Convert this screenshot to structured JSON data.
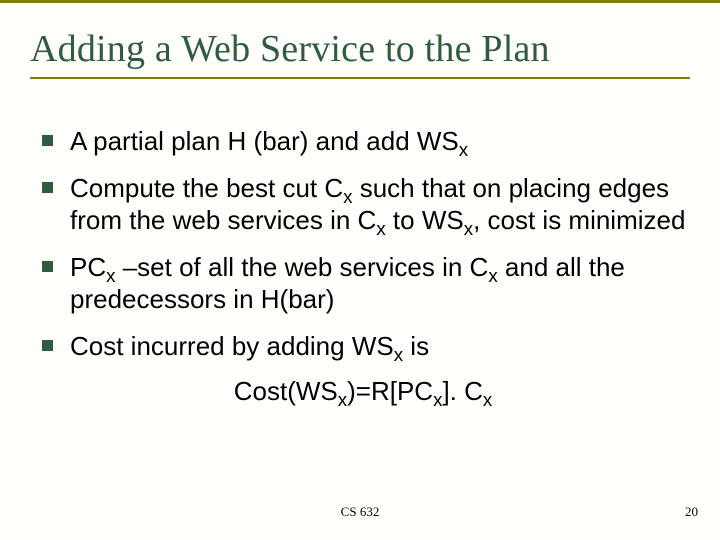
{
  "title": "Adding a Web Service to the Plan",
  "bullets": {
    "b1": {
      "t1": "A partial plan H (bar) and add WS",
      "s1": "x"
    },
    "b2": {
      "t1": "Compute the best cut C",
      "s1": "x",
      "t2": " such that on placing edges from the web services in C",
      "s2": "x",
      "t3": " to WS",
      "s3": "x",
      "t4": ", cost is minimized"
    },
    "b3": {
      "t1": "PC",
      "s1": "x",
      "t2": " –set of all the web services in C",
      "s2": "x",
      "t3": " and all the predecessors in H(bar)"
    },
    "b4": {
      "t1": "Cost incurred by adding WS",
      "s1": "x",
      "t2": " is"
    }
  },
  "formula": {
    "t1": "Cost(WS",
    "s1": "x",
    "t2": ")=R[PC",
    "s2": "x",
    "t3": "]. C",
    "s3": "x"
  },
  "footer": {
    "course": "CS 632",
    "page": "20"
  }
}
